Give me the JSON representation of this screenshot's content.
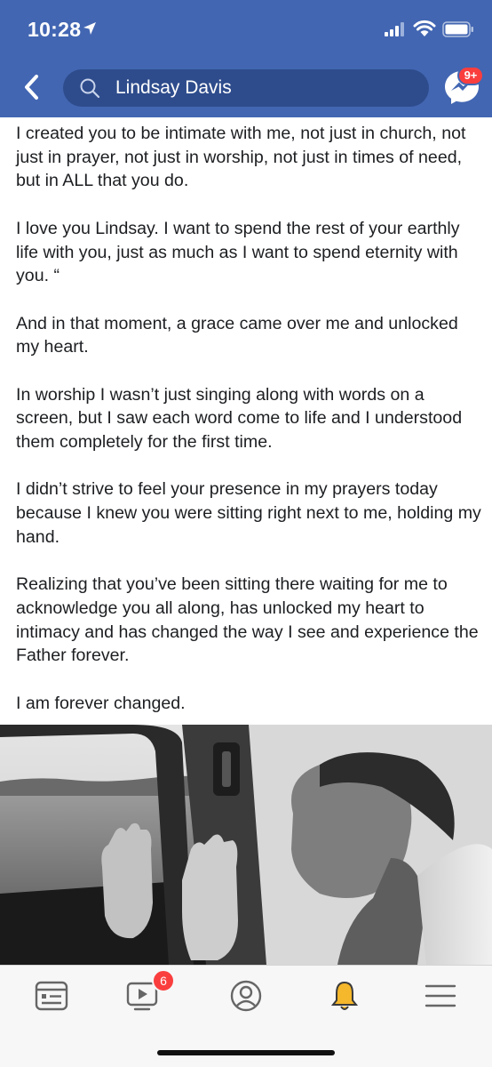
{
  "status": {
    "time": "10:28",
    "icons": [
      "location-arrow-icon",
      "signal-icon",
      "wifi-icon",
      "battery-icon"
    ]
  },
  "header": {
    "search_text": "Lindsay Davis",
    "messenger_badge": "9+",
    "icons": [
      "back-icon",
      "search-icon",
      "messenger-icon"
    ],
    "color": "#4266b2"
  },
  "post": {
    "paragraphs": [
      "I created you to be intimate with me, not just in church, not just in prayer, not just in worship, not just in times of need, but in ALL that you do.",
      "I love you Lindsay. I want to spend the rest of your earthly life with you, just as much as I want to spend eternity with you. “",
      "And in that moment, a grace came over me and unlocked my heart.",
      "In worship I wasn’t just singing along with words on a screen, but I saw each word come to life and I understood them completely for the first time.",
      "I didn’t strive to feel your presence in my prayers today because I knew you were sitting right next to me, holding my hand.",
      "Realizing that you’ve been sitting there waiting for me to acknowledge you all along, has unlocked my heart to intimacy and has changed the way I see and experience the Father forever.",
      "I am forever changed."
    ]
  },
  "tabs": {
    "items": [
      {
        "icon": "news-feed-icon"
      },
      {
        "icon": "watch-icon",
        "badge": "6"
      },
      {
        "icon": "profile-icon"
      },
      {
        "icon": "notifications-bell-icon"
      },
      {
        "icon": "menu-icon"
      }
    ],
    "active_color": "#f5b72b"
  }
}
